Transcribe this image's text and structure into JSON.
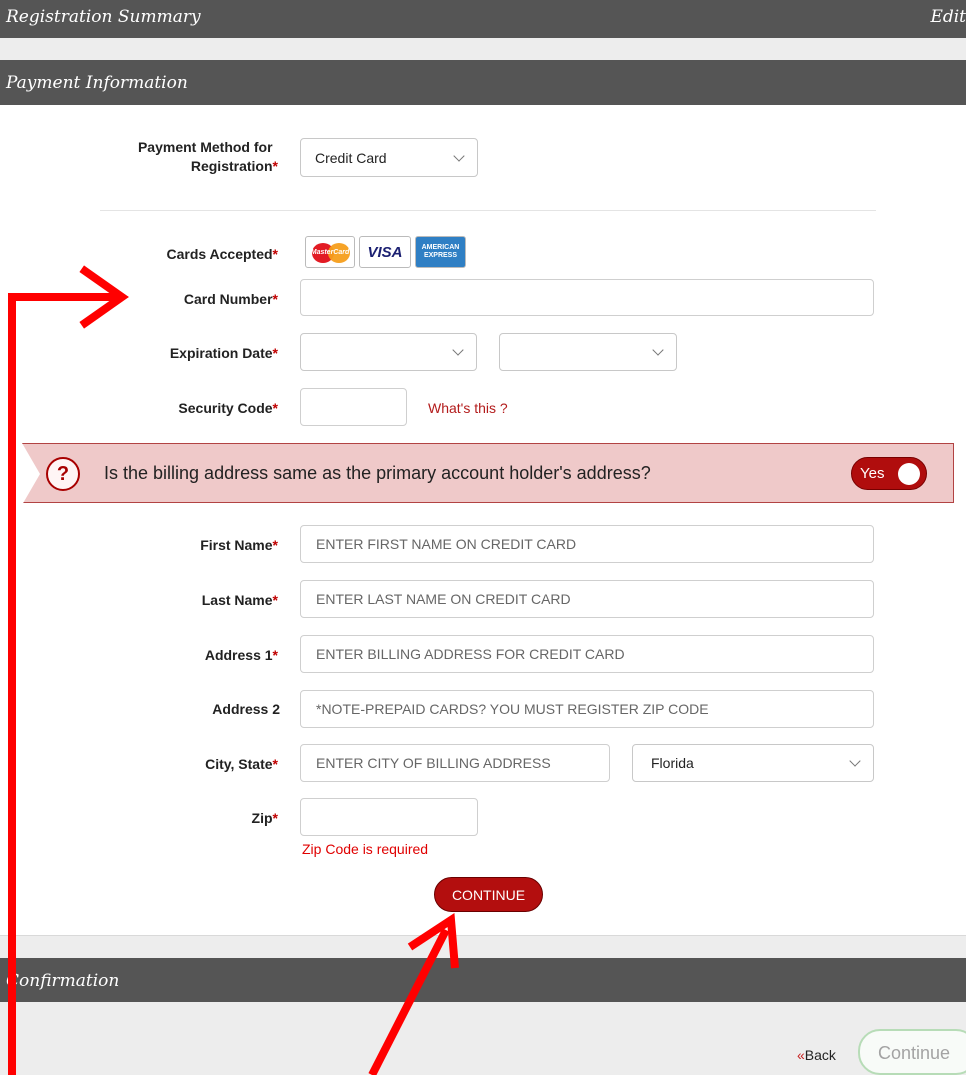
{
  "sections": {
    "summary_title": "Registration Summary",
    "summary_edit": "Edit",
    "payment_title": "Payment Information",
    "confirmation_title": "Confirmation"
  },
  "payment_method": {
    "label": "Payment Method for Registration",
    "required_mark": "*",
    "selected": "Credit Card"
  },
  "cards": {
    "label": "Cards Accepted",
    "required_mark": "*",
    "brands": [
      "MasterCard",
      "VISA",
      "AMERICAN EXPRESS"
    ]
  },
  "card_number": {
    "label": "Card Number",
    "required_mark": "*",
    "value": ""
  },
  "expiration": {
    "label": "Expiration Date",
    "required_mark": "*",
    "month": "",
    "year": ""
  },
  "security": {
    "label": "Security Code",
    "required_mark": "*",
    "value": "",
    "help_link": "What's this ?"
  },
  "billing_question": {
    "text": "Is the billing address same as the primary account holder's address?",
    "icon": "?",
    "toggle_label": "Yes"
  },
  "billing": {
    "first_name": {
      "label": "First Name",
      "required_mark": "*",
      "placeholder": "ENTER FIRST NAME ON CREDIT CARD"
    },
    "last_name": {
      "label": "Last Name",
      "required_mark": "*",
      "placeholder": "ENTER LAST NAME ON CREDIT CARD"
    },
    "address1": {
      "label": "Address 1",
      "required_mark": "*",
      "placeholder": "ENTER BILLING ADDRESS FOR CREDIT CARD"
    },
    "address2": {
      "label": "Address 2",
      "placeholder": "*NOTE-PREPAID CARDS? YOU MUST REGISTER ZIP CODE"
    },
    "city_state": {
      "label": "City, State",
      "required_mark": "*",
      "city_placeholder": "ENTER CITY OF BILLING ADDRESS",
      "state": "Florida"
    },
    "zip": {
      "label": "Zip",
      "required_mark": "*",
      "value": "",
      "error": "Zip Code is required"
    }
  },
  "continue_label": "CONTINUE",
  "footer": {
    "back_chevrons": "«",
    "back_label": "Back",
    "continue_label": "Continue"
  },
  "colors": {
    "accent": "#b30e0e",
    "section_bar": "#555555",
    "annotation_arrow": "#ff0000",
    "banner_bg": "#efc9c9"
  }
}
